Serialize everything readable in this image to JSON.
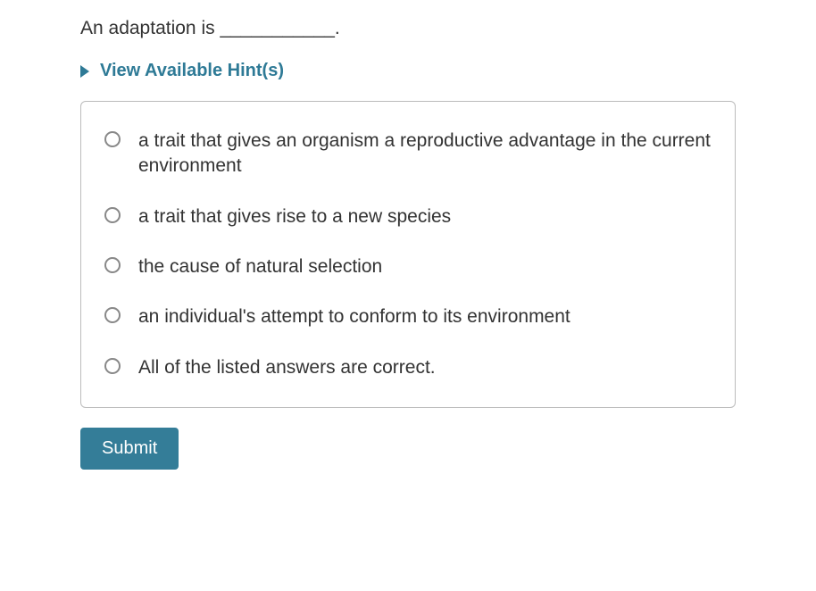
{
  "question": {
    "text": "An adaptation is ___________."
  },
  "hints": {
    "label": "View Available Hint(s)"
  },
  "options": [
    {
      "text": "a trait that gives an organism a reproductive advantage in the current environment"
    },
    {
      "text": "a trait that gives rise to a new species"
    },
    {
      "text": "the cause of natural selection"
    },
    {
      "text": "an individual's attempt to conform to its environment"
    },
    {
      "text": "All of the listed answers are correct."
    }
  ],
  "submit": {
    "label": "Submit"
  }
}
